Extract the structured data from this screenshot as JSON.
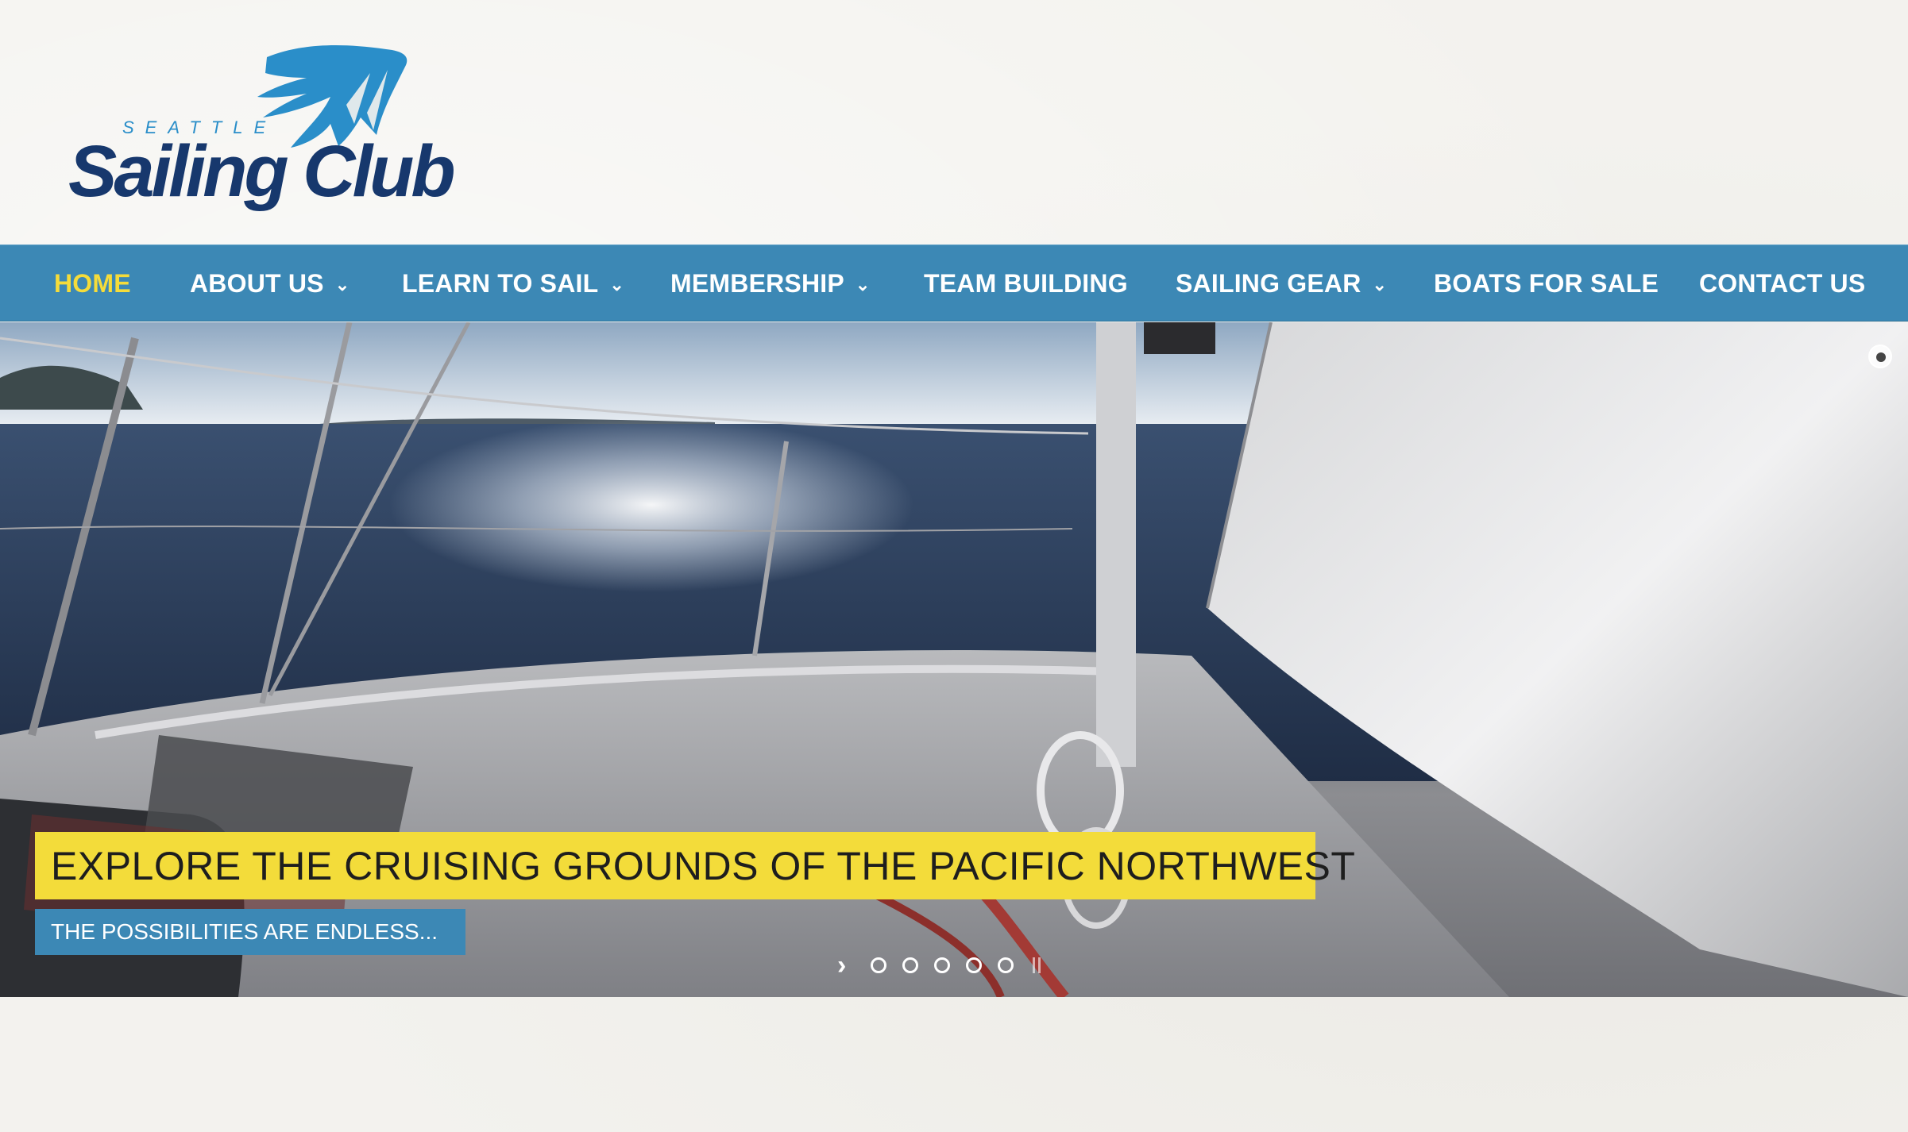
{
  "brand": {
    "city": "SEATTLE",
    "name": "Sailing Club"
  },
  "nav": {
    "items": [
      {
        "label": "HOME",
        "active": true,
        "dropdown": false
      },
      {
        "label": "ABOUT US",
        "active": false,
        "dropdown": true
      },
      {
        "label": "LEARN TO SAIL",
        "active": false,
        "dropdown": true
      },
      {
        "label": "MEMBERSHIP",
        "active": false,
        "dropdown": true
      },
      {
        "label": "TEAM BUILDING",
        "active": false,
        "dropdown": false
      },
      {
        "label": "SAILING GEAR",
        "active": false,
        "dropdown": true
      },
      {
        "label": "BOATS FOR SALE",
        "active": false,
        "dropdown": false
      },
      {
        "label": "CONTACT US",
        "active": false,
        "dropdown": false
      }
    ],
    "dropdown_icon": "chevron-down-icon"
  },
  "hero": {
    "caption": "EXPLORE THE CRUISING GROUNDS OF THE PACIFIC NORTHWEST",
    "subcaption": "THE POSSIBILITIES ARE ENDLESS...",
    "slide_count": 5,
    "next_icon": "chevron-right-icon",
    "pause_icon": "pause-icon"
  },
  "colors": {
    "nav_bg": "#3c88b5",
    "active_nav": "#f5dc3a",
    "caption_bg": "#f3dc3a",
    "subcaption_bg": "#3c88b5",
    "logo_navy": "#17386d",
    "logo_blue": "#2a8ec9"
  }
}
